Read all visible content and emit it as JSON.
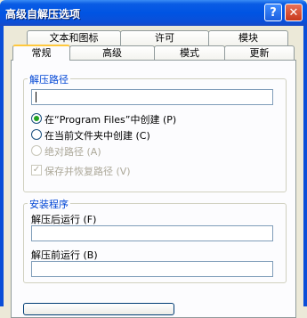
{
  "window": {
    "title": "高级自解压选项",
    "help_button": "?",
    "close_button": "✕"
  },
  "tabs_row_back": [
    {
      "label": "文本和图标"
    },
    {
      "label": "许可"
    },
    {
      "label": "模块"
    }
  ],
  "tabs_row_front": [
    {
      "label": "常规"
    },
    {
      "label": "高级"
    },
    {
      "label": "模式"
    },
    {
      "label": "更新"
    }
  ],
  "extract_path_group": {
    "title": "解压路径",
    "path_value": "",
    "options": [
      {
        "label": "在“Program Files”中创建 (P)",
        "checked": true,
        "disabled": false
      },
      {
        "label": "在当前文件夹中创建 (C)",
        "checked": false,
        "disabled": false
      },
      {
        "label": "绝对路径 (A)",
        "checked": false,
        "disabled": true
      }
    ],
    "save_restore_label": "保存并恢复路径 (V)",
    "save_restore_checked": true
  },
  "setup_group": {
    "title": "安装程序",
    "after_label": "解压后运行 (F)",
    "after_value": "",
    "before_label": "解压前运行 (B)",
    "before_value": ""
  }
}
